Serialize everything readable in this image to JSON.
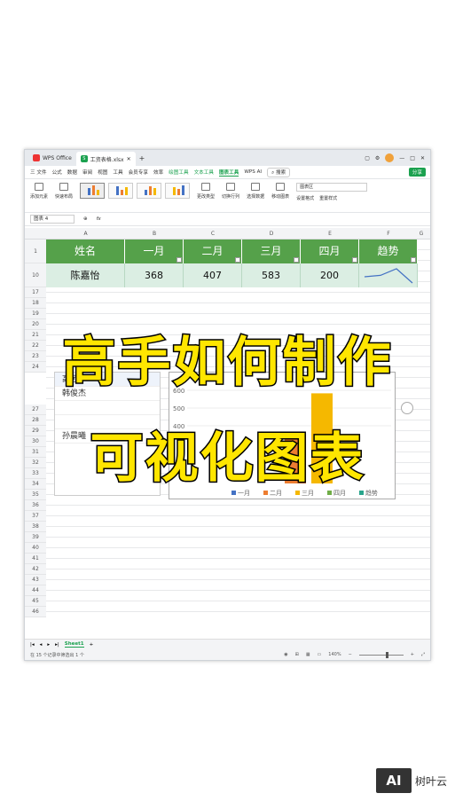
{
  "titlebar": {
    "app_tab": "WPS Office",
    "file_tab": "工资表格.xlsx",
    "plus": "+",
    "s_letter": "S"
  },
  "menubar": {
    "file": "三 文件",
    "items": [
      "公式",
      "数据",
      "审阅",
      "视图",
      "工具",
      "会员专享",
      "效率"
    ],
    "ctx_tabs": [
      "绘图工具",
      "文本工具"
    ],
    "active": "图表工具",
    "ai": "WPS AI",
    "search": "搜索",
    "share": "分享"
  },
  "ribbon": {
    "add_element": "添加元素",
    "quick_layout": "快速布局",
    "change_type": "更改类型",
    "switch_rowcol": "切换行列",
    "select_data": "选择数据",
    "move_chart": "移动图表",
    "chart_area": "图表区",
    "set_format": "设置格式",
    "reset_style": "重置样式"
  },
  "formula_bar": {
    "name_box": "图表 4",
    "fx": "fx"
  },
  "columns": [
    "A",
    "B",
    "C",
    "D",
    "E",
    "F",
    "G"
  ],
  "rows": [
    "1",
    "10",
    "17",
    "18",
    "19",
    "20",
    "21",
    "22",
    "23",
    "24",
    "27",
    "28",
    "29",
    "30",
    "31",
    "32",
    "33",
    "34",
    "35",
    "36",
    "37",
    "38",
    "39",
    "40",
    "41",
    "42",
    "43",
    "44",
    "45",
    "46",
    "47",
    "48",
    "49",
    "50"
  ],
  "table": {
    "headers": [
      "姓名",
      "一月",
      "二月",
      "三月",
      "四月",
      "趋势"
    ],
    "row": [
      "陈嘉怡",
      "368",
      "407",
      "583",
      "200",
      ""
    ]
  },
  "name_panel": {
    "items": [
      "高远",
      "韩俊杰",
      "",
      "",
      "孙晨曦"
    ]
  },
  "chart_data": {
    "type": "bar",
    "categories": [
      "一月",
      "二月",
      "三月",
      "四月",
      "趋势"
    ],
    "y_ticks": [
      "600",
      "500",
      "400"
    ],
    "legend": [
      "一月",
      "二月",
      "三月",
      "四月",
      "趋势"
    ],
    "colors": [
      "#4472c4",
      "#ed7d31",
      "#f5b800",
      "#70ad47",
      "#2aa58c"
    ],
    "visible_values": [
      0,
      350,
      583,
      0,
      0
    ],
    "sparkline": [
      368,
      407,
      583,
      200
    ]
  },
  "sheetbar": {
    "sheet": "Sheet1",
    "add": "+"
  },
  "statusbar": {
    "info": "在 15 个记录中筛选出 1 个",
    "zoom": "140%"
  },
  "overlay": {
    "line1": "高手如何制作",
    "line2": "可视化图表"
  },
  "watermark": {
    "badge": "AI",
    "name": "树叶云"
  }
}
